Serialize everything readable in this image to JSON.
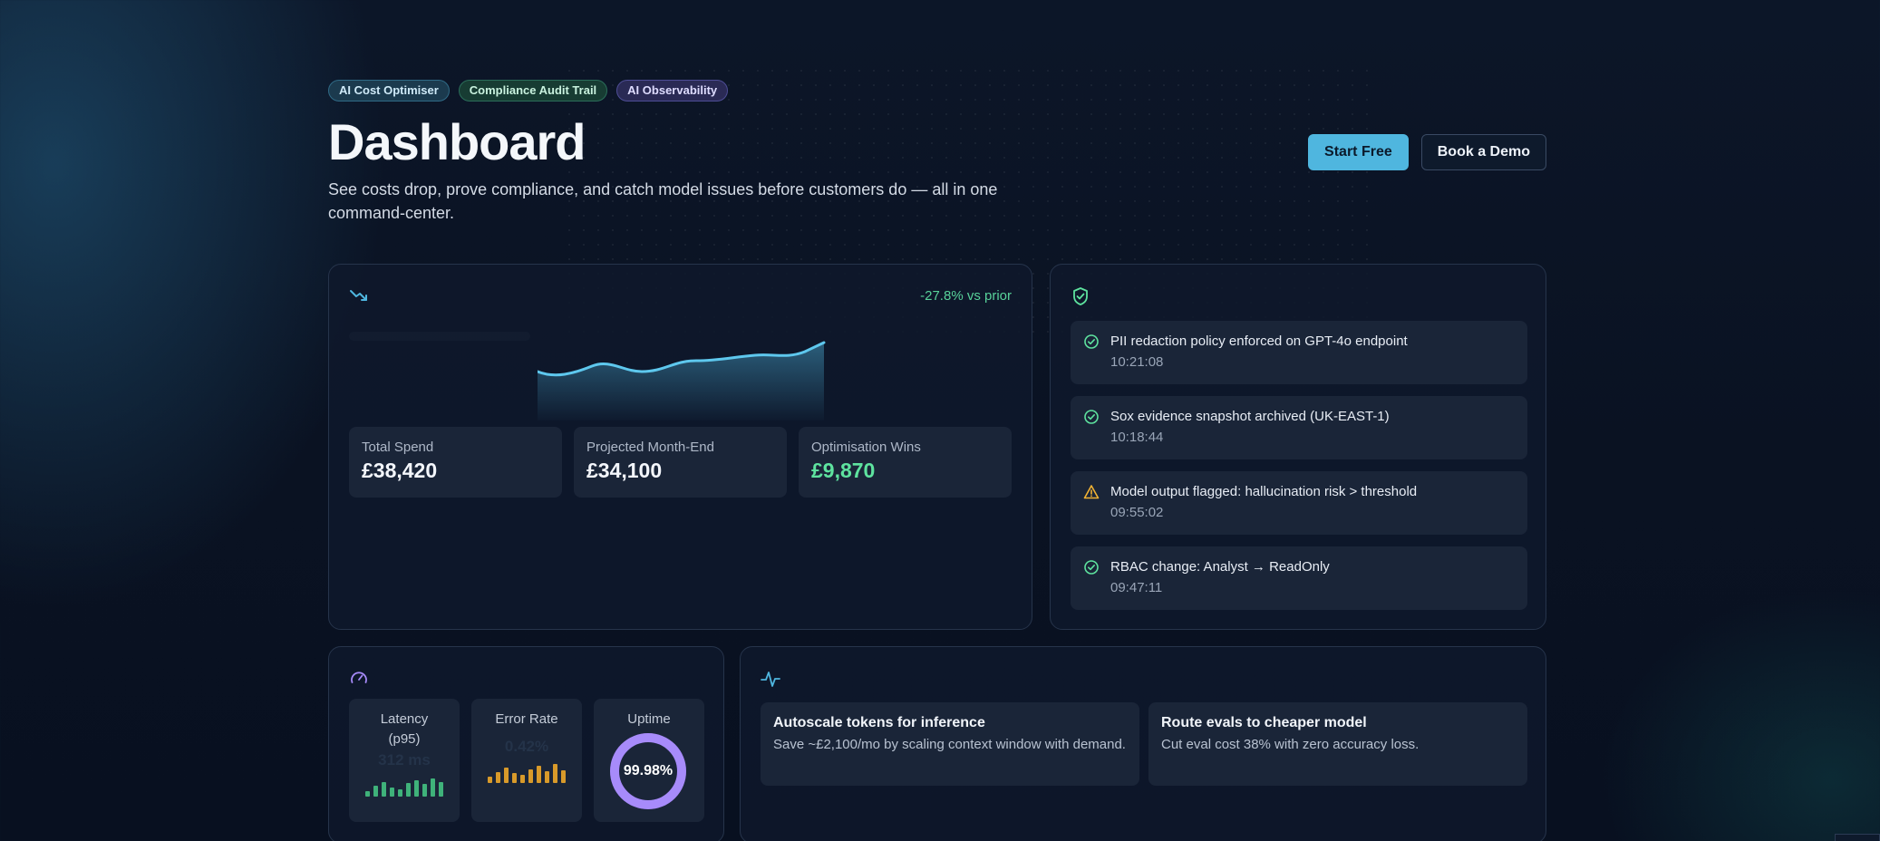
{
  "header": {
    "chips": [
      "AI Cost Optimiser",
      "Compliance Audit Trail",
      "AI Observability"
    ],
    "title": "Dashboard",
    "subtitle": "See costs drop, prove compliance, and catch model issues before customers do — all in one command-center.",
    "cta_primary": "Start Free",
    "cta_secondary": "Book a Demo"
  },
  "cost_card": {
    "title": "",
    "delta": "-27.8% vs prior",
    "stats": [
      {
        "label": "Total Spend",
        "value": "£38,420"
      },
      {
        "label": "Projected Month-End",
        "value": "£34,100"
      },
      {
        "label": "Optimisation Wins",
        "value": "£9,870"
      }
    ]
  },
  "audit_card": {
    "title": "",
    "events": [
      {
        "status": "ok",
        "text": "PII redaction policy enforced on GPT-4o endpoint",
        "time": "10:21:08"
      },
      {
        "status": "ok",
        "text": "Sox evidence snapshot archived (UK-EAST-1)",
        "time": "10:18:44"
      },
      {
        "status": "warn",
        "text": "Model output flagged: hallucination risk > threshold",
        "time": "09:55:02"
      },
      {
        "status": "ok",
        "text": "RBAC change: Analyst → ReadOnly",
        "time": "09:47:11"
      }
    ]
  },
  "observability_card": {
    "title": "",
    "latency": {
      "label": "Latency (p95)",
      "value": "312 ms"
    },
    "error_rate": {
      "label": "Error Rate",
      "value": "0.42%"
    },
    "uptime": {
      "label": "Uptime",
      "value": "99.98%",
      "fraction": 0.9998
    }
  },
  "recommendations_card": {
    "title": "",
    "items": [
      {
        "title": "Autoscale tokens for inference",
        "desc": "Save ~£2,100/mo by scaling context window with demand."
      },
      {
        "title": "Route evals to cheaper model",
        "desc": "Cut eval cost 38% with zero accuracy loss."
      }
    ]
  },
  "colors": {
    "accent": "#4fb6df",
    "positive": "#5ee39f",
    "warning": "#f2b233",
    "latency_bars": "#3fb27a",
    "error_bars": "#d89a2a",
    "uptime_ring": "#a78bfa"
  },
  "icons": {
    "cost": "trend-down-icon",
    "audit": "shield-check-icon",
    "observability": "gauge-icon",
    "recommendations": "activity-pulse-icon",
    "ok": "check-circle-icon",
    "warn": "warning-triangle-icon"
  }
}
